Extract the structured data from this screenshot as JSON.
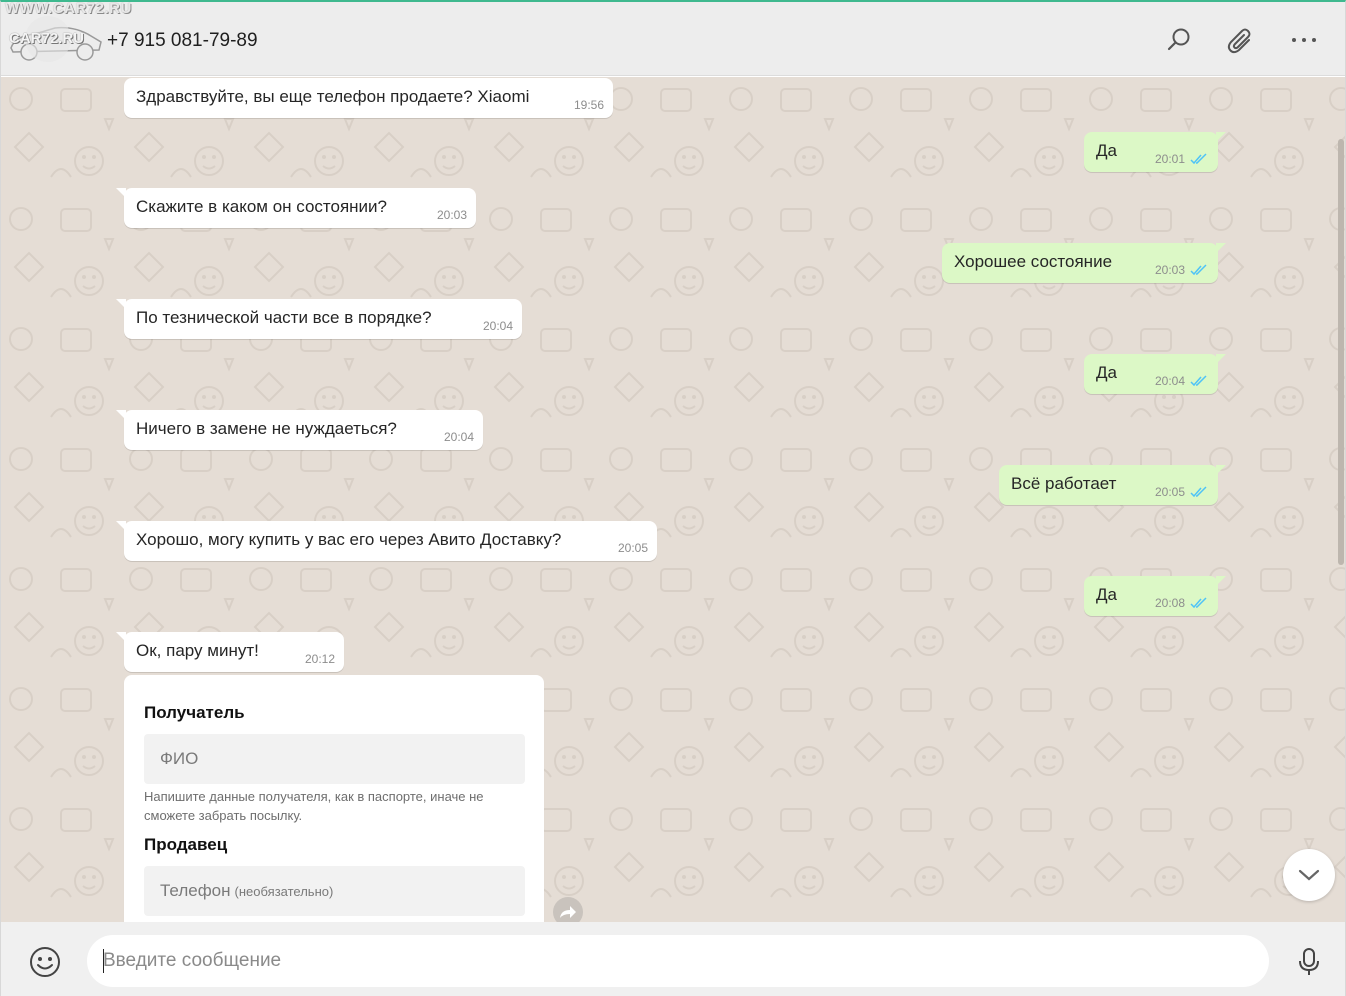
{
  "watermark": {
    "site": "WWW.CAR72.RU",
    "logo": "CAR72.RU"
  },
  "header": {
    "contact_name": "+7 915 081-79-89",
    "icons": [
      "search-icon",
      "attach-icon",
      "more-icon"
    ]
  },
  "colors": {
    "chat_bg": "#e5ddd5",
    "incoming_bg": "#ffffff",
    "outgoing_bg": "#dcf8c6",
    "read_ticks": "#4fc3f7",
    "accent": "#3fb98f"
  },
  "messages": [
    {
      "direction": "in",
      "text": "Здравствуйте, вы еще телефон продаете? Xiaomi",
      "time": "19:56"
    },
    {
      "direction": "out",
      "text": "Да",
      "time": "20:01",
      "status": "read"
    },
    {
      "direction": "in",
      "text": "Скажите в каком он состоянии?",
      "time": "20:03"
    },
    {
      "direction": "out",
      "text": "Хорошее состояние",
      "time": "20:03",
      "status": "read"
    },
    {
      "direction": "in",
      "text": "По тезнической части все в порядке?",
      "time": "20:04"
    },
    {
      "direction": "out",
      "text": "Да",
      "time": "20:04",
      "status": "read"
    },
    {
      "direction": "in",
      "text": "Ничего в замене не нуждаеться?",
      "time": "20:04"
    },
    {
      "direction": "out",
      "text": "Всё работает",
      "time": "20:05",
      "status": "read"
    },
    {
      "direction": "in",
      "text": "Хорошо, могу купить у вас его через Авито Доставку?",
      "time": "20:05"
    },
    {
      "direction": "out",
      "text": "Да",
      "time": "20:08",
      "status": "read"
    },
    {
      "direction": "in",
      "text": "Ок, пару минут!",
      "time": "20:12"
    }
  ],
  "form": {
    "recipient_heading": "Получатель",
    "name_placeholder": "ФИО",
    "hint": "Напишите данные получателя, как в паспорте, иначе не сможете забрать посылку.",
    "seller_heading": "Продавец",
    "phone_label": "Телефон",
    "phone_optional": "(необязательно)"
  },
  "footer": {
    "input_placeholder": "Введите сообщение",
    "icons": [
      "emoji-icon",
      "microphone-icon"
    ]
  }
}
